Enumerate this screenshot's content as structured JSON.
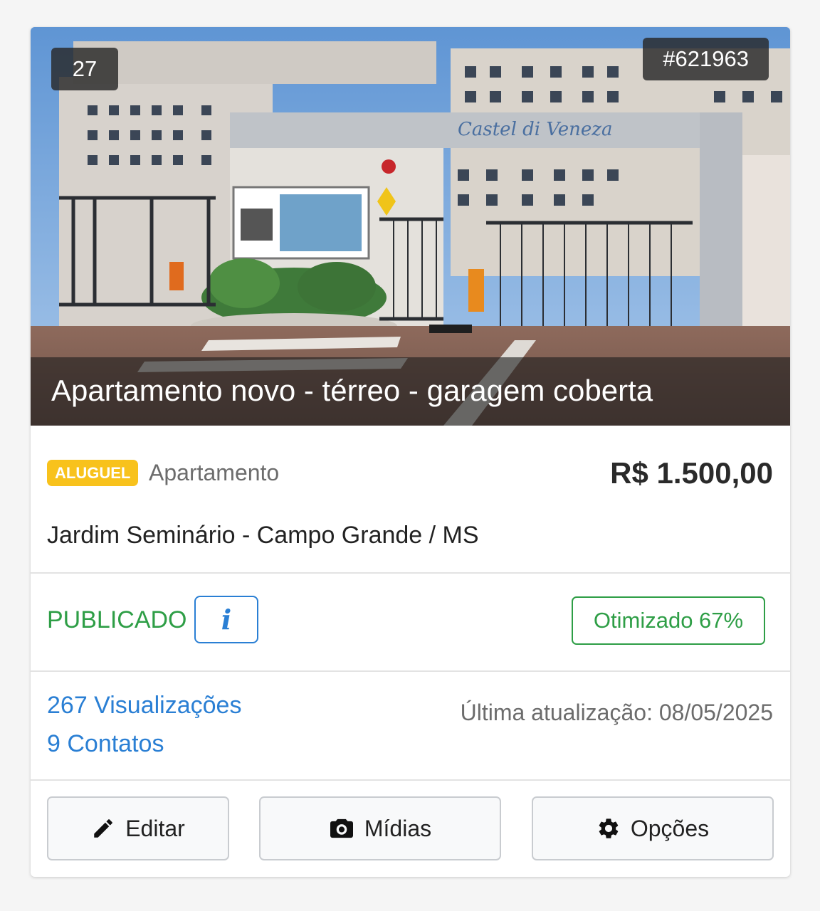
{
  "photo": {
    "count": "27",
    "code": "#621963",
    "title": "Apartamento novo - térreo - garagem coberta"
  },
  "listing": {
    "badge": "ALUGUEL",
    "type": "Apartamento",
    "price": "R$ 1.500,00",
    "location": "Jardim Seminário - Campo Grande / MS"
  },
  "status": {
    "label": "PUBLICADO",
    "optimized": "Otimizado 67%"
  },
  "stats": {
    "views": "267 Visualizações",
    "contacts": "9 Contatos",
    "updated": "Última atualização: 08/05/2025"
  },
  "actions": {
    "edit": "Editar",
    "media": "Mídias",
    "options": "Opções"
  },
  "colors": {
    "badge": "#f8c21c",
    "status_green": "#2e9e46",
    "link_blue": "#2a7fd4"
  },
  "icons": {
    "info": "info-icon",
    "edit": "pencil-icon",
    "media": "camera-icon",
    "options": "gear-icon"
  }
}
